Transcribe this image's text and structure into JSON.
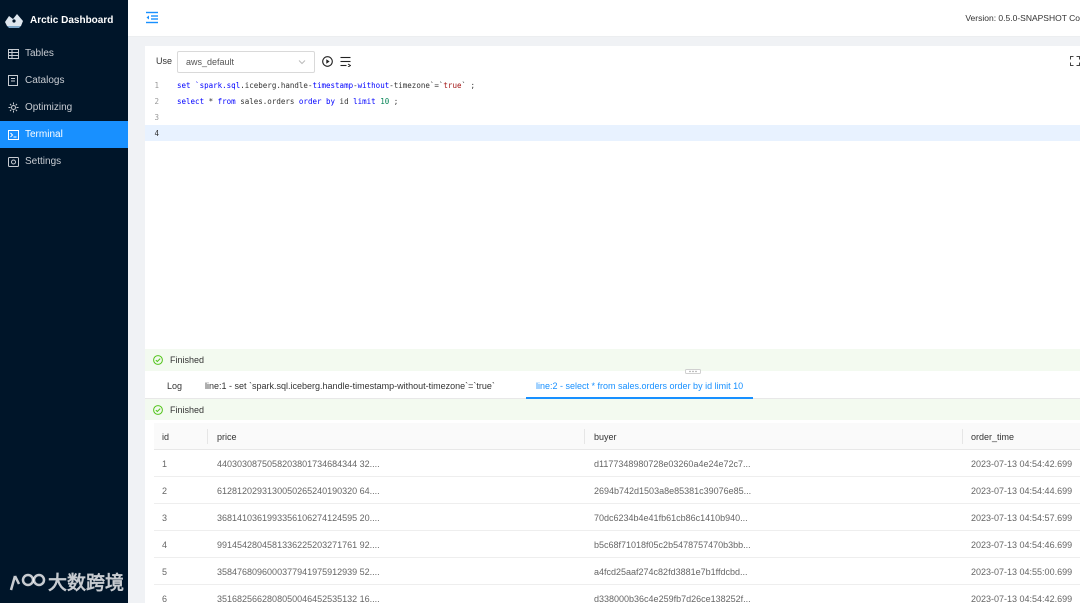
{
  "app": {
    "title": "Arctic Dashboard",
    "version": "Version: 0.5.0-SNAPSHOT  Co"
  },
  "sidebar": {
    "items": [
      {
        "label": "Tables",
        "icon": "table-icon"
      },
      {
        "label": "Catalogs",
        "icon": "catalog-icon"
      },
      {
        "label": "Optimizing",
        "icon": "optimizing-icon"
      },
      {
        "label": "Terminal",
        "icon": "terminal-icon",
        "active": true
      },
      {
        "label": "Settings",
        "icon": "settings-icon"
      }
    ],
    "watermark": "大数跨境"
  },
  "toolbar": {
    "use_label": "Use",
    "catalog_value": "aws_default"
  },
  "editor": {
    "lines": [
      {
        "num": "1"
      },
      {
        "num": "2"
      },
      {
        "num": "3"
      },
      {
        "num": "4"
      }
    ],
    "line1": {
      "a": "set `spark.",
      "b": "sql",
      "c": ".iceberg.handle-",
      "d": "timestamp",
      "e": "-",
      "f": "without",
      "g": "-timezone`=`",
      "h": "true",
      "i": "` ;"
    },
    "line2": {
      "a": "select",
      "b": " * ",
      "c": "from",
      "d": " sales.orders ",
      "e": "order by",
      "f": " id ",
      "g": "limit",
      "h": " ",
      "i": "10",
      "j": " ;"
    }
  },
  "status": {
    "finished": "Finished"
  },
  "tabs": [
    {
      "label": "Log"
    },
    {
      "label": "line:1 - set `spark.sql.iceberg.handle-timestamp-without-timezone`=`true`"
    },
    {
      "label": "line:2 - select * from sales.orders order by id limit 10",
      "active": true
    }
  ],
  "result": {
    "columns": [
      "id",
      "price",
      "buyer",
      "order_time"
    ],
    "rows": [
      [
        "1",
        "4403030875058203801734684344 32....",
        "d1177348980728e03260a4e24e72c7...",
        "2023-07-13 04:54:42.699"
      ],
      [
        "2",
        "6128120293130050265240190320 64....",
        "2694b742d1503a8e85381c39076e85...",
        "2023-07-13 04:54:44.699"
      ],
      [
        "3",
        "3681410361993356106274124595 20....",
        "70dc6234b4e41fb61cb86c1410b940...",
        "2023-07-13 04:54:57.699"
      ],
      [
        "4",
        "9914542804581336225203271761 92....",
        "b5c68f71018f05c2b5478757470b3bb...",
        "2023-07-13 04:54:46.699"
      ],
      [
        "5",
        "3584768096000377941975912939 52....",
        "a4fcd25aaf274c82fd3881e7b1ffdcbd...",
        "2023-07-13 04:55:00.699"
      ],
      [
        "6",
        "3516825662808050046452535132 16....",
        "d338000b36c4e259fb7d26ce138252f...",
        "2023-07-13 04:54:42.699"
      ]
    ]
  },
  "colors": {
    "sidebar_bg": "#001529",
    "accent": "#1890ff",
    "success": "#52c41a"
  }
}
